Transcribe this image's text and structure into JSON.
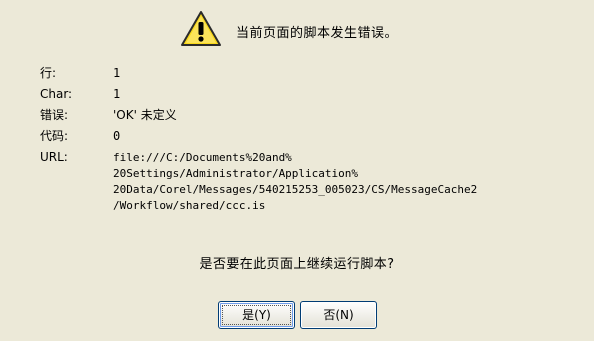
{
  "dialog": {
    "header_text": "当前页面的脚本发生错误。",
    "fields": [
      {
        "label": "行:",
        "value": "1"
      },
      {
        "label": "Char:",
        "value": "1"
      },
      {
        "label": "错误:",
        "value": "'OK' 未定义"
      },
      {
        "label": "代码:",
        "value": "0"
      }
    ],
    "url_label": "URL:",
    "url_lines": [
      "file:///C:/Documents%20and%",
      "20Settings/Administrator/Application%",
      "20Data/Corel/Messages/540215253_005023/CS/MessageCache2",
      "/Workflow/shared/ccc.is"
    ],
    "question": "是否要在此页面上继续运行脚本?",
    "buttons": {
      "yes_label": "是(Y)",
      "no_label": "否(N)"
    },
    "icon": "warning-icon",
    "colors": {
      "background": "#ece9d8",
      "warning_yellow": "#f8d81c",
      "button_border": "#003c74"
    }
  }
}
